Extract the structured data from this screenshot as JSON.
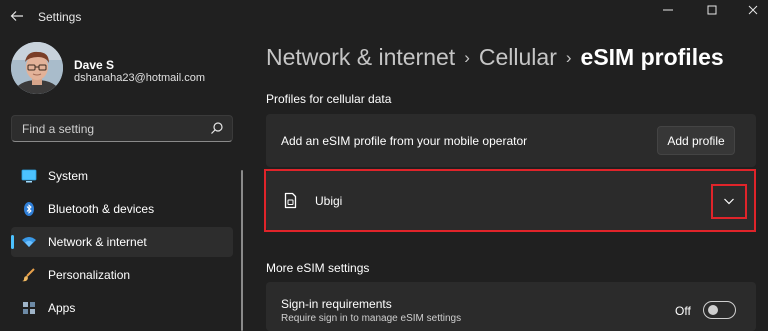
{
  "window": {
    "title": "Settings",
    "back_icon": "arrow-left-icon",
    "minimize_icon": "minimize-icon",
    "maximize_icon": "maximize-icon",
    "close_icon": "close-icon"
  },
  "user": {
    "name": "Dave S",
    "email": "dshanaha23@hotmail.com"
  },
  "search": {
    "placeholder": "Find a setting",
    "value": "",
    "icon": "search-icon"
  },
  "sidebar": {
    "items": [
      {
        "label": "System",
        "icon": "monitor-icon",
        "active": false
      },
      {
        "label": "Bluetooth & devices",
        "icon": "bluetooth-icon",
        "active": false
      },
      {
        "label": "Network & internet",
        "icon": "wifi-icon",
        "active": true
      },
      {
        "label": "Personalization",
        "icon": "brush-icon",
        "active": false
      },
      {
        "label": "Apps",
        "icon": "apps-icon",
        "active": false
      }
    ]
  },
  "breadcrumb": {
    "parts": [
      "Network & internet",
      "Cellular",
      "eSIM profiles"
    ],
    "separator": "›"
  },
  "profiles_section": {
    "heading": "Profiles for cellular data",
    "add_card_text": "Add an eSIM profile from your mobile operator",
    "add_button_label": "Add profile",
    "profile_name": "Ubigi",
    "profile_icon": "sim-card-icon",
    "expand_icon": "chevron-down-icon"
  },
  "more_section": {
    "heading": "More eSIM settings",
    "signin_title": "Sign-in requirements",
    "signin_desc": "Require sign in to manage eSIM settings",
    "toggle_state": "Off"
  },
  "colors": {
    "background": "#202020",
    "card": "#2b2b2b",
    "accent": "#4cc2ff",
    "highlight": "#e0242a"
  }
}
